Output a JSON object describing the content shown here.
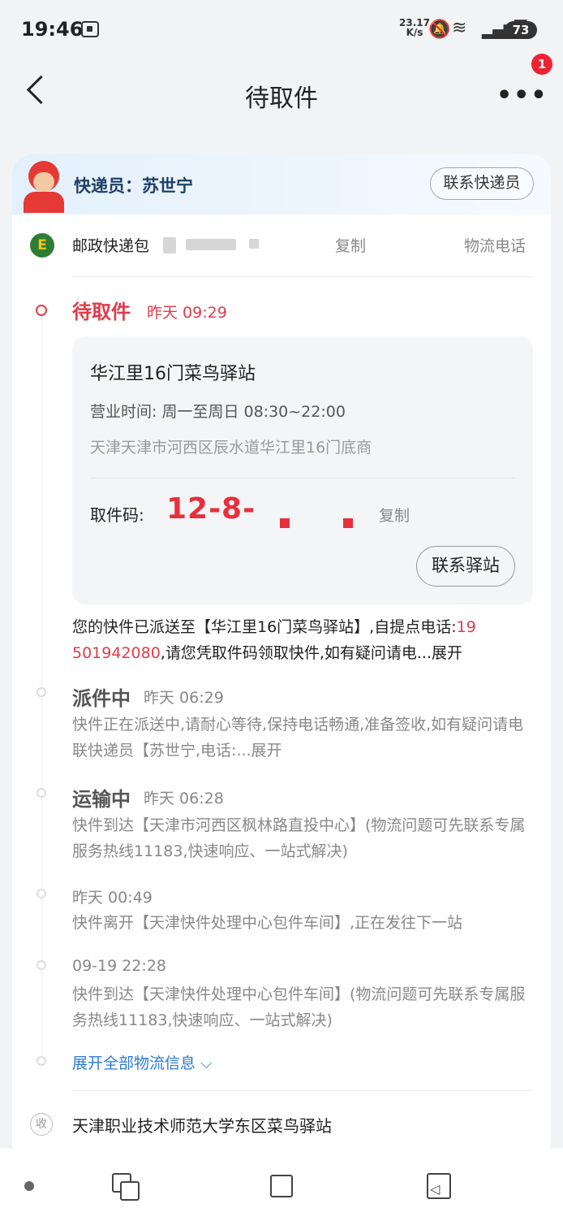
{
  "status_bar": {
    "time": "19:46",
    "net_speed_value": "23.17",
    "net_speed_unit": "K/s",
    "battery": "73"
  },
  "nav": {
    "title": "待取件",
    "more": "•••",
    "badge": "1"
  },
  "courier": {
    "label": "快递员：苏世宁",
    "contact_button": "联系快递员"
  },
  "carrier": {
    "name": "邮政快递包",
    "copy": "复制",
    "phone": "物流电话",
    "logo_char": "E"
  },
  "current": {
    "status": "待取件",
    "time": "昨天 09:29",
    "station": {
      "name": "华江里16门菜鸟驿站",
      "hours_label": "营业时间:",
      "hours": "周一至周日 08:30~22:00",
      "address": "天津天津市河西区辰水道华江里16门底商",
      "pickup_label": "取件码:",
      "pickup_code": "12-8-",
      "copy": "复制",
      "contact_button": "联系驿站"
    },
    "desc_a": "您的快件已派送至【华江里16门菜鸟驿站】,自提点电话:",
    "desc_phone_a": "19",
    "desc_phone_b": "501942080",
    "desc_b": ",请您凭取件码领取快件,如有疑问请电...展开"
  },
  "events": [
    {
      "status": "派件中",
      "time": "昨天 06:29",
      "desc": "快件正在派送中,请耐心等待,保持电话畅通,准备签收,如有疑问请电联快递员【苏世宁,电话:...展开"
    },
    {
      "status": "运输中",
      "time": "昨天 06:28",
      "desc": "快件到达【天津市河西区枫林路直投中心】(物流问题可先联系专属服务热线11183,快速响应、一站式解决)"
    },
    {
      "status": "",
      "time": "昨天 00:49",
      "desc": "快件离开【天津快件处理中心包件车间】,正在发往下一站"
    },
    {
      "status": "",
      "time": "09-19 22:28",
      "desc": "快件到达【天津快件处理中心包件车间】(物流问题可先联系专属服务热线11183,快速响应、一站式解决)"
    }
  ],
  "expand_all": "展开全部物流信息 ⌵",
  "receiver": {
    "icon_char": "收",
    "address": "天津职业技术师范大学东区菜鸟驿站"
  }
}
